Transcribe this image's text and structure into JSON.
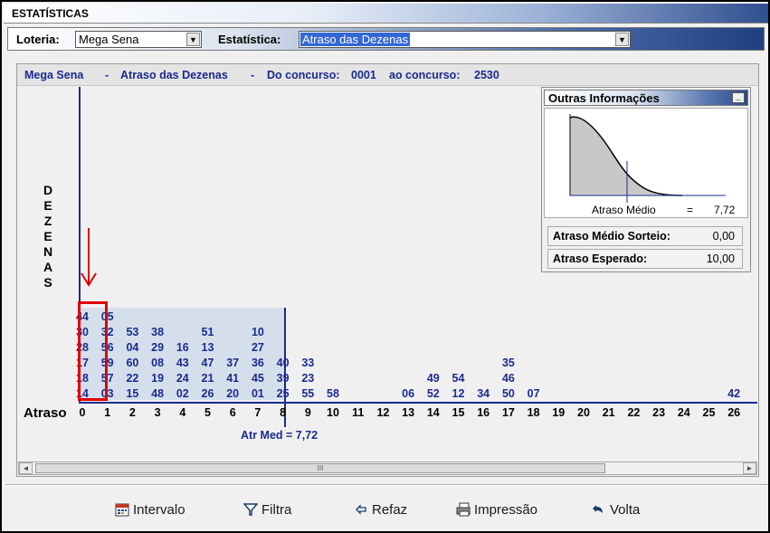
{
  "window": {
    "title": "ESTATÍSTICAS"
  },
  "toolbar": {
    "loteria_label": "Loteria:",
    "loteria_value": "Mega Sena",
    "estatistica_label": "Estatística:",
    "estatistica_value": "Atraso das Dezenas"
  },
  "header": {
    "game": "Mega Sena",
    "sep1": "-",
    "stat": "Atraso das Dezenas",
    "sep2": "-",
    "from_label": "Do concurso:",
    "from_value": "0001",
    "to_label": "ao concurso:",
    "to_value": "2530"
  },
  "y_axis_label": "DEZENAS",
  "x_axis_label": "Atraso",
  "x_ticks": [
    "0",
    "1",
    "2",
    "3",
    "4",
    "5",
    "6",
    "7",
    "8",
    "9",
    "10",
    "11",
    "12",
    "13",
    "14",
    "15",
    "16",
    "17",
    "18",
    "19",
    "20",
    "21",
    "22",
    "23",
    "24",
    "25",
    "26"
  ],
  "columns": [
    [
      "44",
      "30",
      "28",
      "17",
      "18",
      "14"
    ],
    [
      "05",
      "32",
      "56",
      "59",
      "57",
      "03"
    ],
    [
      "53",
      "04",
      "60",
      "22",
      "15"
    ],
    [
      "38",
      "29",
      "08",
      "19",
      "48"
    ],
    [
      "16",
      "43",
      "24",
      "02"
    ],
    [
      "51",
      "13",
      "47",
      "21",
      "26"
    ],
    [
      "37",
      "41",
      "20"
    ],
    [
      "10",
      "27",
      "36",
      "45",
      "01"
    ],
    [
      "40",
      "39",
      "25"
    ],
    [
      "33",
      "23",
      "55"
    ],
    [
      "58"
    ],
    [],
    [],
    [
      "06"
    ],
    [
      "49",
      "52"
    ],
    [
      "54",
      "12"
    ],
    [
      "34"
    ],
    [
      "35",
      "46",
      "50"
    ],
    [
      "07"
    ],
    [],
    [],
    [],
    [],
    [],
    [],
    [],
    [
      "42"
    ]
  ],
  "atr_med_label": "Atr Med = 7,72",
  "info": {
    "title": "Outras Informações",
    "min_glyph": "_",
    "atraso_medio_label": "Atraso Médio",
    "atraso_medio_eq": "=",
    "atraso_medio_value": "7,72",
    "sorteio_label": "Atraso Médio Sorteio:",
    "sorteio_value": "0,00",
    "esperado_label": "Atraso Esperado:",
    "esperado_value": "10,00"
  },
  "scroll": {
    "grip": "III"
  },
  "buttons": {
    "intervalo": "Intervalo",
    "filtra": "Filtra",
    "refaz": "Refaz",
    "impressao": "Impressão",
    "volta": "Volta"
  }
}
